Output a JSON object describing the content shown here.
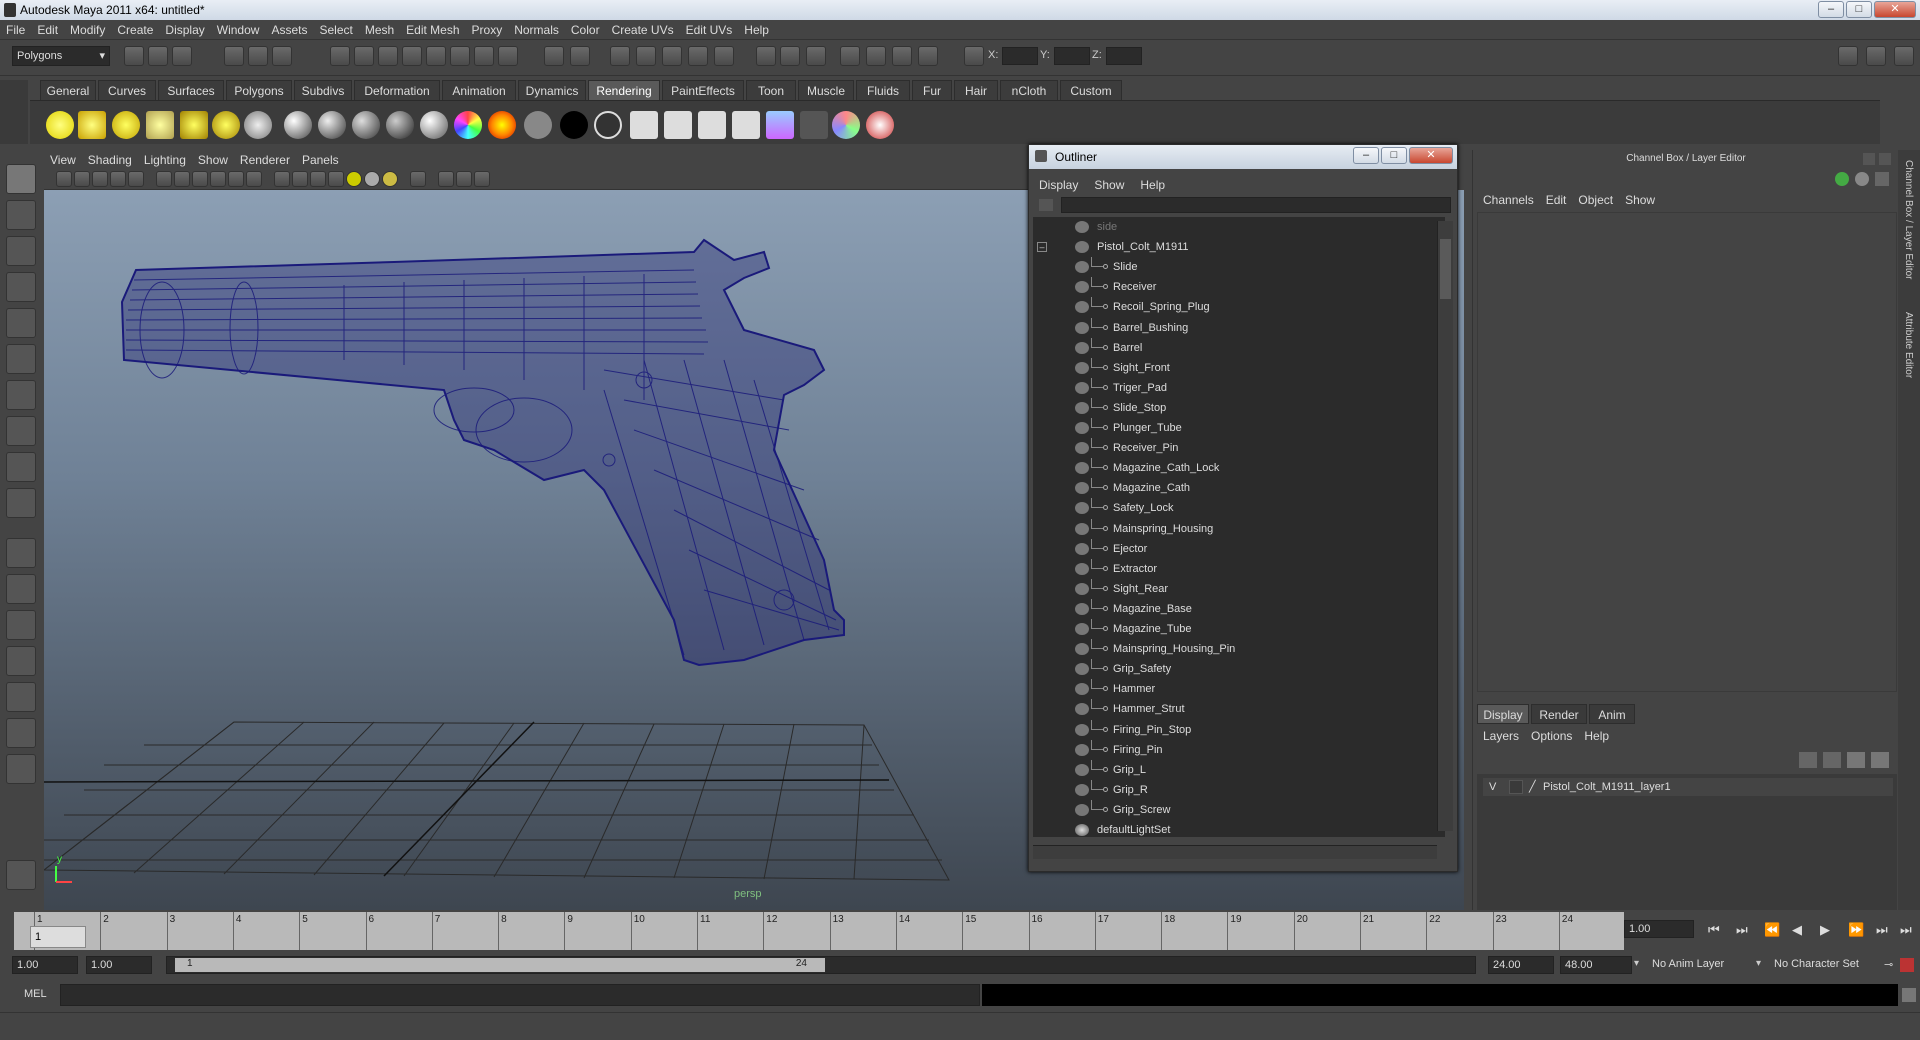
{
  "window": {
    "title": "Autodesk Maya 2011 x64: untitled*"
  },
  "menubar": [
    "File",
    "Edit",
    "Modify",
    "Create",
    "Display",
    "Window",
    "Assets",
    "Select",
    "Mesh",
    "Edit Mesh",
    "Proxy",
    "Normals",
    "Color",
    "Create UVs",
    "Edit UVs",
    "Help"
  ],
  "status_line": {
    "mode": "Polygons",
    "x_label": "X:",
    "y_label": "Y:",
    "z_label": "Z:"
  },
  "shelf": {
    "tabs": [
      "General",
      "Curves",
      "Surfaces",
      "Polygons",
      "Subdivs",
      "Deformation",
      "Animation",
      "Dynamics",
      "Rendering",
      "PaintEffects",
      "Toon",
      "Muscle",
      "Fluids",
      "Fur",
      "Hair",
      "nCloth",
      "Custom"
    ],
    "active_tab": "Rendering"
  },
  "viewport": {
    "menu": [
      "View",
      "Shading",
      "Lighting",
      "Show",
      "Renderer",
      "Panels"
    ],
    "camera_label": "persp",
    "wire_color": "#1a1a7a"
  },
  "outliner": {
    "title": "Outliner",
    "menu": [
      "Display",
      "Show",
      "Help"
    ],
    "items": [
      {
        "label": "side",
        "depth": 0,
        "dim": true
      },
      {
        "label": "Pistol_Colt_M1911",
        "depth": 0,
        "expanded": true
      },
      {
        "label": "Slide",
        "depth": 1
      },
      {
        "label": "Receiver",
        "depth": 1
      },
      {
        "label": "Recoil_Spring_Plug",
        "depth": 1
      },
      {
        "label": "Barrel_Bushing",
        "depth": 1
      },
      {
        "label": "Barrel",
        "depth": 1
      },
      {
        "label": "Sight_Front",
        "depth": 1
      },
      {
        "label": "Triger_Pad",
        "depth": 1
      },
      {
        "label": "Slide_Stop",
        "depth": 1
      },
      {
        "label": "Plunger_Tube",
        "depth": 1
      },
      {
        "label": "Receiver_Pin",
        "depth": 1
      },
      {
        "label": "Magazine_Cath_Lock",
        "depth": 1
      },
      {
        "label": "Magazine_Cath",
        "depth": 1
      },
      {
        "label": "Safety_Lock",
        "depth": 1
      },
      {
        "label": "Mainspring_Housing",
        "depth": 1
      },
      {
        "label": "Ejector",
        "depth": 1
      },
      {
        "label": "Extractor",
        "depth": 1
      },
      {
        "label": "Sight_Rear",
        "depth": 1
      },
      {
        "label": "Magazine_Base",
        "depth": 1
      },
      {
        "label": "Magazine_Tube",
        "depth": 1
      },
      {
        "label": "Mainspring_Housing_Pin",
        "depth": 1
      },
      {
        "label": "Grip_Safety",
        "depth": 1
      },
      {
        "label": "Hammer",
        "depth": 1
      },
      {
        "label": "Hammer_Strut",
        "depth": 1
      },
      {
        "label": "Firing_Pin_Stop",
        "depth": 1
      },
      {
        "label": "Firing_Pin",
        "depth": 1
      },
      {
        "label": "Grip_L",
        "depth": 1
      },
      {
        "label": "Grip_R",
        "depth": 1
      },
      {
        "label": "Grip_Screw",
        "depth": 1
      },
      {
        "label": "defaultLightSet",
        "depth": 0
      }
    ]
  },
  "channel_box": {
    "title": "Channel Box / Layer Editor",
    "menu": [
      "Channels",
      "Edit",
      "Object",
      "Show"
    ],
    "layer_tabs": [
      "Display",
      "Render",
      "Anim"
    ],
    "layer_menu": [
      "Layers",
      "Options",
      "Help"
    ],
    "layer": {
      "visibility": "V",
      "name": "Pistol_Colt_M1911_layer1"
    },
    "side_labels": [
      "Channel Box / Layer Editor",
      "Attribute Editor"
    ]
  },
  "time_slider": {
    "frames": [
      "1",
      "2",
      "3",
      "4",
      "5",
      "6",
      "7",
      "8",
      "9",
      "10",
      "11",
      "12",
      "13",
      "14",
      "15",
      "16",
      "17",
      "18",
      "19",
      "20",
      "21",
      "22",
      "23",
      "24"
    ],
    "current_frame_display": "1",
    "current_time": "1.00"
  },
  "range_slider": {
    "start_time": "1.00",
    "playback_start": "1.00",
    "range_start_label": "1",
    "range_end_label": "24",
    "playback_end": "24.00",
    "end_time": "48.00",
    "anim_layer": "No Anim Layer",
    "character_set": "No Character Set"
  },
  "command_line": {
    "label": "MEL"
  }
}
